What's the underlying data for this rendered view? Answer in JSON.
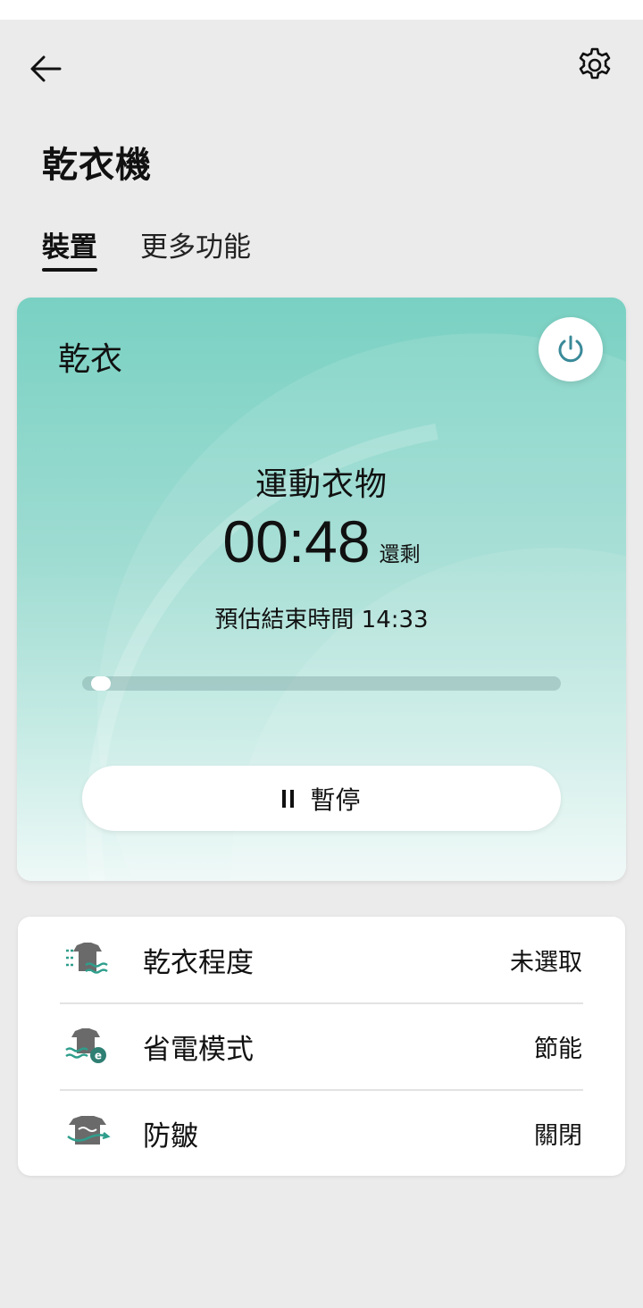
{
  "header": {
    "title": "乾衣機",
    "back_icon": "arrow-left-icon",
    "settings_icon": "gear-icon"
  },
  "tabs": [
    {
      "label": "裝置",
      "active": true
    },
    {
      "label": "更多功能",
      "active": false
    }
  ],
  "status_card": {
    "mode": "乾衣",
    "course": "運動衣物",
    "remaining_time": "00:48",
    "remaining_suffix": "還剩",
    "estimated_end": "預估結束時間 14:33",
    "progress_fraction": 0.02,
    "pause_label": "暫停",
    "power_icon": "power-icon",
    "accent_color": "#3a8a99"
  },
  "settings": [
    {
      "icon": "drying-level-icon",
      "label": "乾衣程度",
      "value": "未選取"
    },
    {
      "icon": "eco-mode-icon",
      "label": "省電模式",
      "value": "節能"
    },
    {
      "icon": "anti-wrinkle-icon",
      "label": "防皺",
      "value": "關閉"
    }
  ]
}
